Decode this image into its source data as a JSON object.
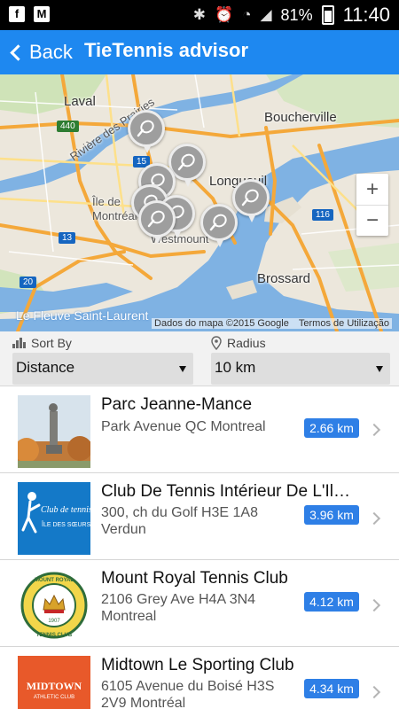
{
  "status_bar": {
    "battery": "81%",
    "time": "11:40",
    "left_icons": [
      "facebook-icon",
      "gmail-icon"
    ],
    "right_icons": [
      "bluetooth-icon",
      "alarm-icon",
      "wifi-icon",
      "signal-icon",
      "battery-icon"
    ]
  },
  "app_bar": {
    "back_label": "Back",
    "title": "TieTennis advisor",
    "color": "#1e88f0"
  },
  "map": {
    "labels": {
      "laval": "Laval",
      "boucherville": "Boucherville",
      "longueuil": "Longueuil",
      "ile_de": "Île de",
      "montreal": "Montréal",
      "westmount": "Westmount",
      "brossard": "Brossard",
      "riviere": "Rivière des Prairies",
      "fleuve": "Le Fleuve Saint-Laurent"
    },
    "road_badges": [
      "440",
      "15",
      "13",
      "20",
      "116",
      "20"
    ],
    "zoom_in": "+",
    "zoom_out": "−",
    "attribution_data": "Dados do mapa ©2015 Google",
    "attribution_terms": "Termos de Utilização",
    "pin_icon": "tennis-racket-icon"
  },
  "filters": {
    "sort_label": "Sort By",
    "sort_value": "Distance",
    "radius_label": "Radius",
    "radius_value": "10 km"
  },
  "clubs": [
    {
      "name": "Parc Jeanne-Mance",
      "address_line1": "Park Avenue QC Montreal",
      "address_line2": "",
      "distance": "2.66 km"
    },
    {
      "name": "Club De Tennis Intérieur De L'Ile des Soeurs",
      "address_line1": "300, ch du Golf H3E 1A8",
      "address_line2": "Verdun",
      "distance": "3.96 km",
      "logo_text1": "Club de tennis",
      "logo_text2": "ÎLE DES SŒURS"
    },
    {
      "name": "Mount Royal Tennis Club",
      "address_line1": "2106 Grey Ave H4A 3N4",
      "address_line2": "Montreal",
      "distance": "4.12 km",
      "logo_text1": "MOUNT ROYAL",
      "logo_text2": "TENNIS CLUB",
      "logo_text3": "1907"
    },
    {
      "name": "Midtown Le Sporting Club",
      "address_line1": "6105 Avenue du Boisé H3S",
      "address_line2": "2V9 Montréal",
      "distance": "4.34 km",
      "logo_text1": "MIDTOWN",
      "logo_text2": "ATHLETIC CLUB"
    }
  ],
  "colors": {
    "accent": "#1e88f0",
    "badge": "#2e7fe6",
    "map_water": "#7fb2e3",
    "map_road": "#f4a83a",
    "midtown_orange": "#e8592a"
  }
}
